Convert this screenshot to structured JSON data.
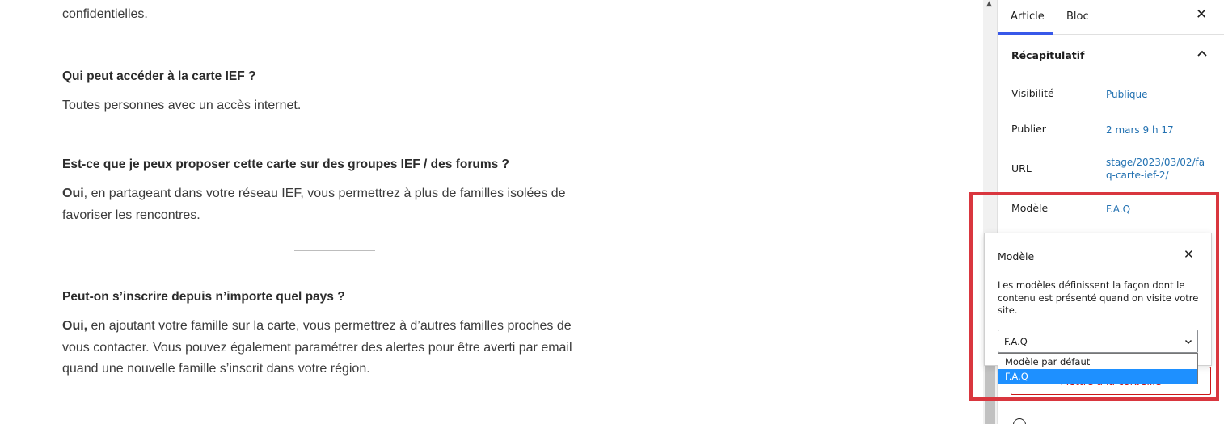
{
  "editor": {
    "paragraphs": {
      "intro_tail": "confidentielles.",
      "q1": "Qui peut accéder à la carte IEF ?",
      "a1": "Toutes personnes avec un accès internet.",
      "q2": "Est-ce que je peux proposer cette carte sur des groupes IEF / des forums ?",
      "a2_bold": "Oui",
      "a2_line1": ", en partageant dans votre réseau IEF, vous permettrez à plus de familles isolées de",
      "a2_line2": "favoriser les rencontres.",
      "q3": "Peut-on s’inscrire depuis n’importe quel pays ?",
      "a3_bold": "Oui,",
      "a3_line1": " en ajoutant votre famille sur la carte, vous permettrez à d’autres familles proches de",
      "a3_line2": "vous contacter. Vous pouvez également paramétrer des alertes pour être averti par email",
      "a3_line3": "quand une nouvelle famille s’inscrit dans votre région."
    }
  },
  "sidebar": {
    "tabs": {
      "article": "Article",
      "bloc": "Bloc"
    },
    "close_icon": "close-icon",
    "panel": {
      "title": "Récapitulatif",
      "rows": {
        "visibility": {
          "label": "Visibilité",
          "value": "Publique"
        },
        "publish": {
          "label": "Publier",
          "value": "2 mars 9 h 17"
        },
        "url": {
          "label": "URL",
          "value_line1": "stage/2023/03/02/fa",
          "value_line2": "q-carte-ief-2/"
        },
        "template": {
          "label": "Modèle",
          "value": "F.A.Q"
        }
      }
    },
    "trash_button": "Mettre à la corbeille"
  },
  "popover": {
    "title": "Modèle",
    "description": "Les modèles définissent la façon dont le contenu est présenté quand on visite votre site.",
    "select": {
      "value": "F.A.Q",
      "options": [
        "Modèle par défaut",
        "F.A.Q"
      ],
      "highlighted_index": 1
    }
  },
  "colors": {
    "accent": "#3858e9",
    "link": "#2271b1",
    "danger": "#cc1818",
    "highlight_annotation": "#d9363e",
    "option_selected": "#1e90ff"
  }
}
